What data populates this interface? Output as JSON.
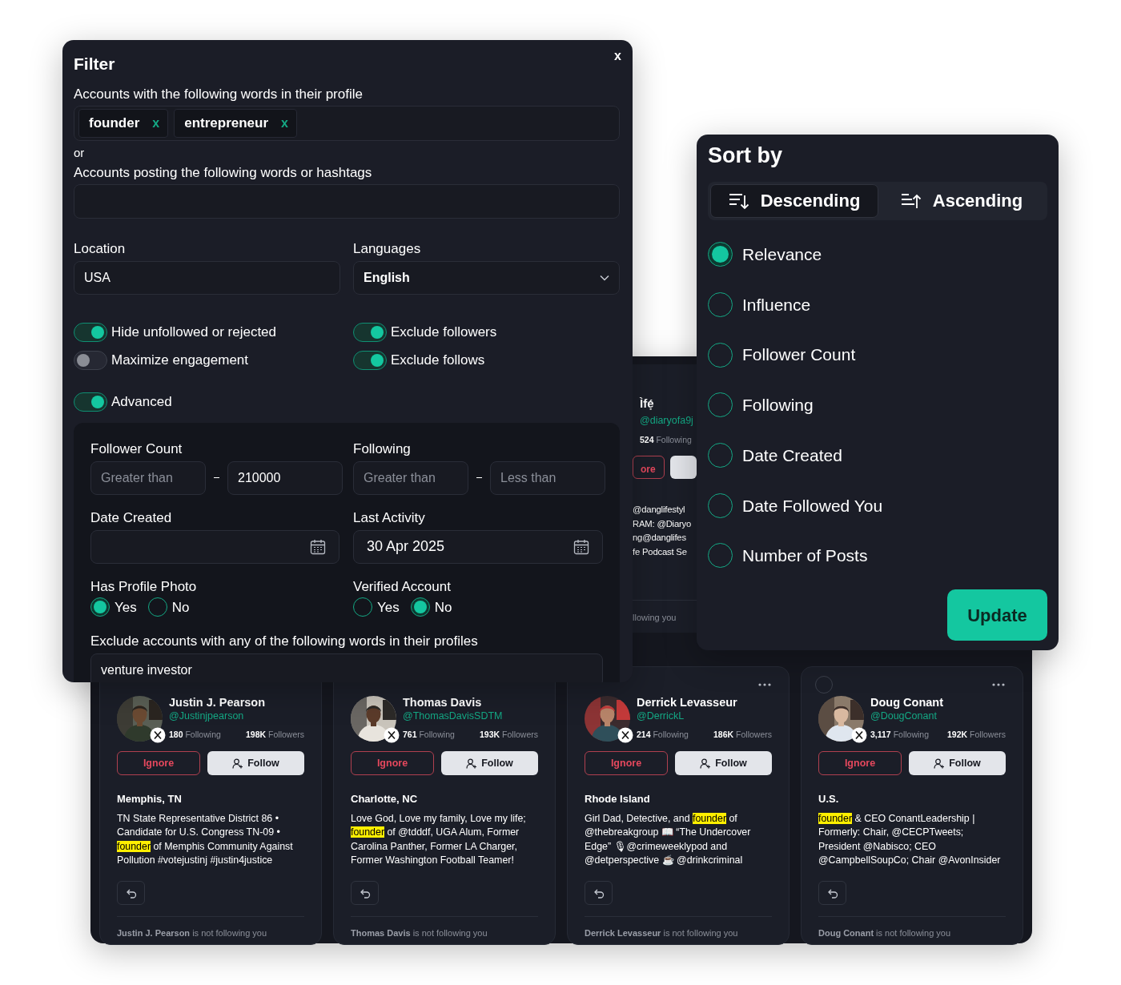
{
  "results_panel": {
    "peek_card": {
      "name": "Ìfẹ́",
      "handle": "@diaryofa9j",
      "following_count": "524",
      "following_label": "Following",
      "ignore_button": "ore",
      "bio_lines": [
        "@danglifestyl",
        "RAM: @Diaryo",
        "ng@danglifes",
        "fe Podcast Se"
      ],
      "footer": "llowing you"
    },
    "cards": [
      {
        "name": "Justin J. Pearson",
        "handle": "@Justinjpearson",
        "following_count": "180",
        "following_label": "Following",
        "followers_count": "198K",
        "followers_label": "Followers",
        "ignore_button": "Ignore",
        "follow_button": "Follow",
        "location": "Memphis, TN",
        "bio": "TN State Representative District 86 • Candidate for U.S. Congress TN-09 • **founder** of Memphis Community Against Pollution #votejustinj #justin4justice",
        "footer_name": "Justin J. Pearson",
        "footer_text": "is not following you",
        "has_menu": false
      },
      {
        "name": "Thomas Davis",
        "handle": "@ThomasDavisSDTM",
        "following_count": "761",
        "following_label": "Following",
        "followers_count": "193K",
        "followers_label": "Followers",
        "ignore_button": "Ignore",
        "follow_button": "Follow",
        "location": "Charlotte, NC",
        "bio": "Love God, Love my family, Love my life; **founder** of @tdddf, UGA Alum, Former Carolina Panther, Former LA Charger, Former Washington Football Teamer!",
        "footer_name": "Thomas Davis",
        "footer_text": "is not following you",
        "has_menu": false
      },
      {
        "name": "Derrick Levasseur",
        "handle": "@DerrickL",
        "following_count": "214",
        "following_label": "Following",
        "followers_count": "186K",
        "followers_label": "Followers",
        "ignore_button": "Ignore",
        "follow_button": "Follow",
        "location": "Rhode Island",
        "bio": "Girl Dad, Detective, and **founder** of @thebreakgroup 📖 “The Undercover Edge” 🎙@crimeweeklypod and @detperspective ☕ @drinkcriminal",
        "footer_name": "Derrick Levasseur",
        "footer_text": "is not following you",
        "has_menu": true
      },
      {
        "name": "Doug Conant",
        "handle": "@DougConant",
        "following_count": "3,117",
        "following_label": "Following",
        "followers_count": "192K",
        "followers_label": "Followers",
        "ignore_button": "Ignore",
        "follow_button": "Follow",
        "location": "U.S.",
        "bio": "**founder** & CEO ConantLeadership | Formerly: Chair, @CECPTweets; President @Nabisco; CEO @CampbellSoupCo; Chair @AvonInsider",
        "footer_name": "Doug Conant",
        "footer_text": "is not following you",
        "has_menu": true,
        "selected": false
      }
    ]
  },
  "filter": {
    "title": "Filter",
    "close": "x",
    "profile_words_label": "Accounts with the following words in their profile",
    "profile_words": [
      {
        "text": "founder",
        "remove": "x"
      },
      {
        "text": "entrepreneur",
        "remove": "x"
      }
    ],
    "or_label": "or",
    "posting_words_label": "Accounts posting the following words or hashtags",
    "location": {
      "label": "Location",
      "value": "USA"
    },
    "languages": {
      "label": "Languages",
      "value": "English"
    },
    "toggles": [
      {
        "label": "Hide unfollowed or rejected",
        "on": true
      },
      {
        "label": "Exclude followers",
        "on": true
      },
      {
        "label": "Maximize engagement",
        "on": false
      },
      {
        "label": "Exclude follows",
        "on": true
      }
    ],
    "advanced": {
      "label": "Advanced",
      "on": true,
      "follower_count": {
        "label": "Follower Count",
        "min": {
          "placeholder": "Greater than"
        },
        "max": {
          "value": "210000"
        }
      },
      "following": {
        "label": "Following",
        "min": {
          "placeholder": "Greater than"
        },
        "max": {
          "placeholder": "Less than"
        }
      },
      "date_created": {
        "label": "Date Created"
      },
      "last_activity": {
        "label": "Last Activity",
        "value": "30 Apr 2025"
      },
      "has_profile_photo": {
        "label": "Has Profile Photo",
        "options": [
          {
            "label": "Yes",
            "selected": true
          },
          {
            "label": "No",
            "selected": false
          }
        ]
      },
      "verified_account": {
        "label": "Verified Account",
        "options": [
          {
            "label": "Yes",
            "selected": false
          },
          {
            "label": "No",
            "selected": true
          }
        ]
      },
      "exclude_words": {
        "label": "Exclude accounts with any of the following words in their profiles",
        "value": "venture investor"
      }
    }
  },
  "sort": {
    "title": "Sort by",
    "directions": [
      {
        "label": "Descending",
        "kind": "descending",
        "selected": true
      },
      {
        "label": "Ascending",
        "kind": "ascending",
        "selected": false
      }
    ],
    "options": [
      {
        "label": "Relevance",
        "selected": true
      },
      {
        "label": "Influence",
        "selected": false
      },
      {
        "label": "Follower Count",
        "selected": false
      },
      {
        "label": "Following",
        "selected": false
      },
      {
        "label": "Date Created",
        "selected": false
      },
      {
        "label": "Date Followed You",
        "selected": false
      },
      {
        "label": "Number of Posts",
        "selected": false
      }
    ],
    "update_button": "Update"
  }
}
